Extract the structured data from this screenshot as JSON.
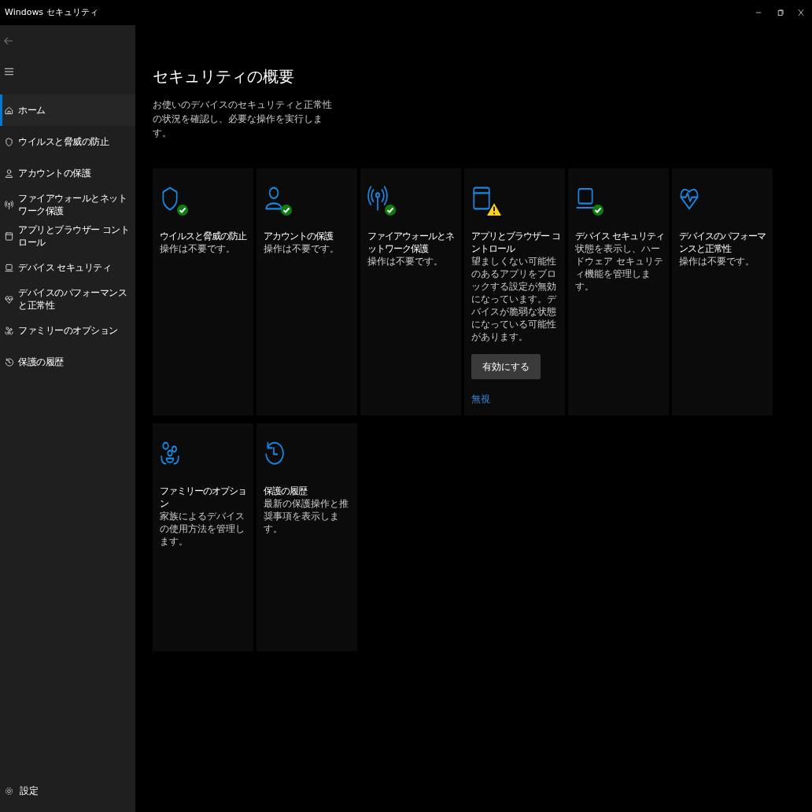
{
  "window": {
    "title": "Windows セキュリティ"
  },
  "sidebar": {
    "items": [
      {
        "label": "ホーム",
        "kind": "home",
        "selected": true
      },
      {
        "label": "ウイルスと脅威の防止",
        "kind": "shield",
        "selected": false
      },
      {
        "label": "アカウントの保護",
        "kind": "person",
        "selected": false
      },
      {
        "label": "ファイアウォールとネットワーク保護",
        "kind": "antenna",
        "selected": false
      },
      {
        "label": "アプリとブラウザー コントロール",
        "kind": "browser",
        "selected": false
      },
      {
        "label": "デバイス セキュリティ",
        "kind": "laptop",
        "selected": false
      },
      {
        "label": "デバイスのパフォーマンスと正常性",
        "kind": "heart",
        "selected": false
      },
      {
        "label": "ファミリーのオプション",
        "kind": "family",
        "selected": false
      },
      {
        "label": "保護の履歴",
        "kind": "history",
        "selected": false
      }
    ],
    "settings": {
      "label": "設定"
    }
  },
  "page": {
    "title": "セキュリティの概要",
    "description": "お使いのデバイスのセキュリティと正常性の状況を確認し、必要な操作を実行します。"
  },
  "cards": [
    {
      "kind": "shield",
      "healthy": true,
      "warning": false,
      "title": "ウイルスと脅威の防止",
      "text": "操作は不要です。"
    },
    {
      "kind": "person",
      "healthy": true,
      "warning": false,
      "title": "アカウントの保護",
      "text": "操作は不要です。"
    },
    {
      "kind": "antenna",
      "healthy": true,
      "warning": false,
      "title": "ファイアウォールとネットワーク保護",
      "text": "操作は不要です。"
    },
    {
      "kind": "browser",
      "healthy": false,
      "warning": true,
      "title": "アプリとブラウザー コントロール",
      "text": "望ましくない可能性のあるアプリをブロックする設定が無効になっています。デバイスが脆弱な状態になっている可能性があります。",
      "button": "有効にする",
      "link": "無視"
    },
    {
      "kind": "laptop",
      "healthy": true,
      "warning": false,
      "title": "デバイス セキュリティ",
      "text": "状態を表示し、ハードウェア セキュリティ機能を管理します。"
    },
    {
      "kind": "heart",
      "healthy": false,
      "warning": false,
      "title": "デバイスのパフォーマンスと正常性",
      "text": "操作は不要です。"
    },
    {
      "kind": "family",
      "healthy": false,
      "warning": false,
      "title": "ファミリーのオプション",
      "text": "家族によるデバイスの使用方法を管理します。"
    },
    {
      "kind": "history",
      "healthy": false,
      "warning": false,
      "title": "保護の履歴",
      "text": "最新の保護操作と推奨事項を表示します。"
    }
  ]
}
